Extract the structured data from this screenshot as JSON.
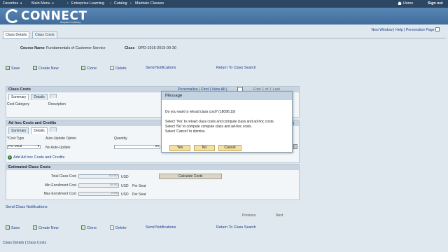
{
  "topnav": {
    "favorites": "Favorites",
    "main_menu": "Main Menu",
    "breadcrumb": [
      "Enterprise Learning",
      "Catalog",
      "Maintain Classes"
    ],
    "home": "Home",
    "signout": "Sign out"
  },
  "banner": {
    "logo": "CONNECT",
    "tagline": "Maryland Judiciary"
  },
  "utility": {
    "new_window": "New Window",
    "help": "Help",
    "personalize": "Personalize Page"
  },
  "tabs": {
    "class_details": "Class Details",
    "class_costs": "Class Costs"
  },
  "header": {
    "course_label": "Course Name",
    "course_value": "Fundamentals of Customer Service",
    "class_label": "Class",
    "class_value": "OPD-1016-2015-09-30"
  },
  "toolbar": {
    "save": "Save",
    "create_new": "Create New",
    "clone": "Clone",
    "delete": "Delete",
    "send_notifications": "Send Notifications",
    "return_search": "Return To Class Search"
  },
  "class_costs": {
    "title": "Class Costs",
    "nav": "Personalize | Find | View All |",
    "pager": "First  1 of 1  Last",
    "tab_summary": "Summary",
    "tab_details": "Details",
    "col_category": "Cost Category",
    "col_description": "Description"
  },
  "adhoc": {
    "title": "Ad hoc Costs and Credits",
    "tab_summary": "Summary",
    "tab_details": "Details",
    "col_cost_type": "*Cost Type",
    "col_auto_update": "Auto-Update Option",
    "col_quantity": "Quantity",
    "cost_type_value": "Per Meal",
    "auto_update_value": "No Auto-Update",
    "quantity_value": "20",
    "add_link": "Add Ad hoc Costs and Credits"
  },
  "estimated": {
    "title": "Estimated Class Costs",
    "total_label": "Total Class Cost",
    "total_value": "82.80",
    "min_label": "Min Enrollment Cost",
    "min_value": "16.56",
    "max_label": "Max Enrollment Cost",
    "max_value": "2.65",
    "currency": "USD",
    "per_seat": "Per Seat",
    "calc_button": "Calculate Costs"
  },
  "send_link": "Send Class Notifications",
  "pagination": {
    "previous": "Previous",
    "next": "Next"
  },
  "footer": {
    "class_details": "Class Details",
    "class_costs": "Class Costs"
  },
  "modal": {
    "title": "Message",
    "question": "Do you want to reload class cost? (18096,19)",
    "line1": "Select 'Yes' to reload class costs and compute class and ad-hoc costs.",
    "line2": "Select 'No' to compute compute class and ad-hoc costs.",
    "line3": "Select 'Cancel' to dismiss.",
    "yes": "Yes",
    "no": "No",
    "cancel": "Cancel"
  }
}
